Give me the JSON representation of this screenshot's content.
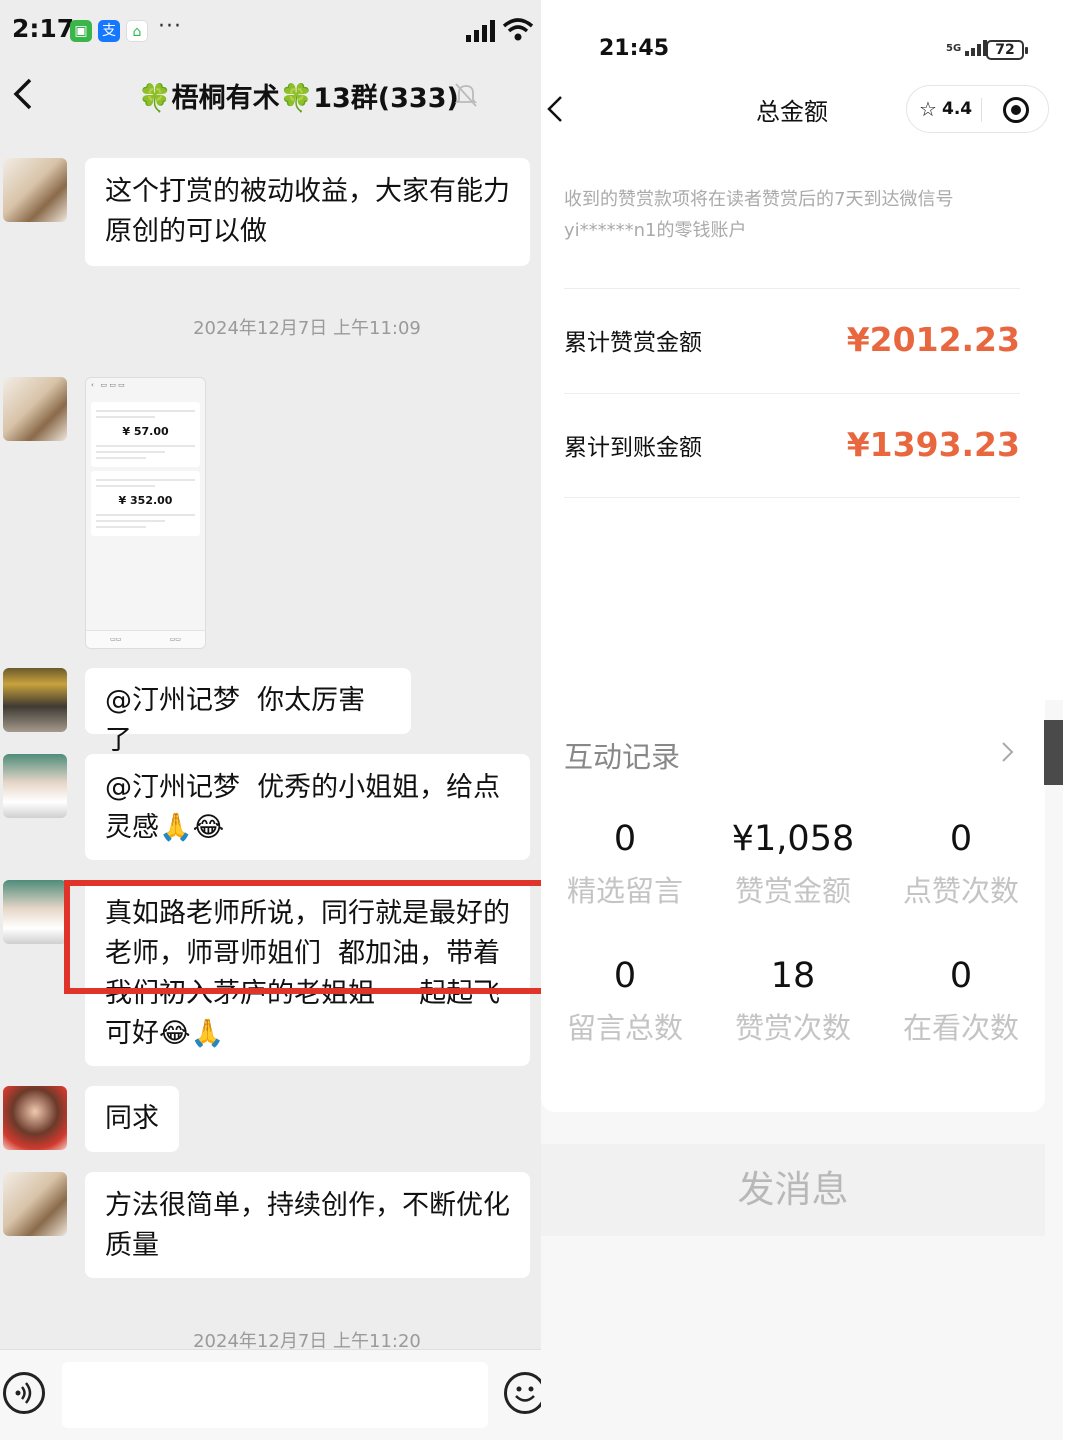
{
  "left": {
    "status": {
      "time": "2:17",
      "more": "···"
    },
    "header": {
      "title": "🍀梧桐有术🍀13群(333)"
    },
    "messages": [
      {
        "text": "这个打赏的被动收益，大家有能力\n原创的可以做"
      },
      {
        "text": "@汀州记梦  你太厉害了"
      },
      {
        "text": "@汀州记梦  优秀的小姐姐，给点\n灵感🙏😂"
      },
      {
        "text": "真如路老师所说，同行就是最好的\n老师，师哥师姐们  都加油，带着\n我们初入茅庐的老姐姐  一起起飞\n可好😂🙏"
      },
      {
        "text": "同求"
      },
      {
        "text": "方法很简单，持续创作，不断优化\n质量"
      }
    ],
    "timestamps": [
      "2024年12月7日 上午11:09",
      "2024年12月7日 上午11:20"
    ],
    "thumbnail": {
      "amount1": "¥ 57.00",
      "amount2": "¥ 352.00"
    },
    "icons": {
      "back": "chevron-left-icon",
      "mute": "bell-off-icon",
      "voice": "voice-icon",
      "emoji": "emoji-icon"
    }
  },
  "right": {
    "status": {
      "time": "21:45",
      "network": "5G",
      "battery": "72"
    },
    "header": {
      "title": "总金额",
      "rating": "4.4"
    },
    "note": "收到的赞赏款项将在读者赞赏后的7天到达微信号yi******n1的零钱账户",
    "rows": [
      {
        "label": "累计赞赏金额",
        "value": "¥2012.23"
      },
      {
        "label": "累计到账金额",
        "value": "¥1393.23"
      }
    ],
    "card": {
      "title": "互动记录",
      "stats": [
        {
          "num": "0",
          "label": "精选留言"
        },
        {
          "num": "¥1,058",
          "label": "赞赏金额"
        },
        {
          "num": "0",
          "label": "点赞次数"
        },
        {
          "num": "0",
          "label": "留言总数"
        },
        {
          "num": "18",
          "label": "赞赏次数"
        },
        {
          "num": "0",
          "label": "在看次数"
        }
      ]
    },
    "send_button": "发消息",
    "colors": {
      "amount": "#e8673f",
      "highlight_box": "#e0332a"
    }
  }
}
